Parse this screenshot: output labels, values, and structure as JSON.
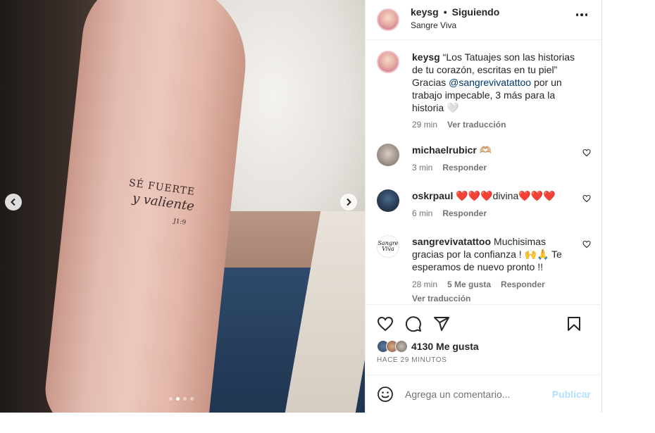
{
  "header": {
    "username": "keysg",
    "separator": "•",
    "follow_status": "Siguiendo",
    "location": "Sangre Viva"
  },
  "media": {
    "tattoo_text_line1": "SÉ FUERTE",
    "tattoo_text_line2": "y valiente",
    "tattoo_text_line3": "J1:9",
    "carousel_dots": 4,
    "carousel_active_index": 1
  },
  "caption": {
    "username": "keysg",
    "text_before": "“Los Tatuajes son las historias de tu corazón, escritas en tu piel” Gracias ",
    "mention": "@sangrevivatattoo",
    "text_after": " por un trabajo impecable, 3 más para la historia 🤍",
    "time": "29 min",
    "translate": "Ver traducción"
  },
  "comments": [
    {
      "username": "michaelrubicr",
      "text": "🫶🏼",
      "time": "3 min",
      "reply": "Responder"
    },
    {
      "username": "oskrpaul",
      "text": "❤️❤️❤️divina❤️❤️❤️",
      "time": "6 min",
      "reply": "Responder"
    },
    {
      "username": "sangrevivatattoo",
      "avatar_text": "Sangre Viva",
      "text": "Muchisimas gracias por la confianza ! 🙌🙏 Te esperamos de nuevo pronto !!",
      "time": "28 min",
      "likes": "5 Me gusta",
      "reply": "Responder",
      "translate": "Ver traducción"
    }
  ],
  "actions": {
    "likes_count": "4130 Me gusta",
    "time_ago": "HACE 29 MINUTOS"
  },
  "add_comment": {
    "placeholder": "Agrega un comentario...",
    "publish": "Publicar"
  },
  "colors": {
    "mention": "#00376b",
    "publish_disabled": "#b2dffc",
    "secondary_text": "#737373"
  },
  "icons": [
    "chevron-left-icon",
    "chevron-right-icon",
    "more-icon",
    "heart-icon",
    "comment-icon",
    "share-icon",
    "bookmark-icon",
    "emoji-icon"
  ]
}
